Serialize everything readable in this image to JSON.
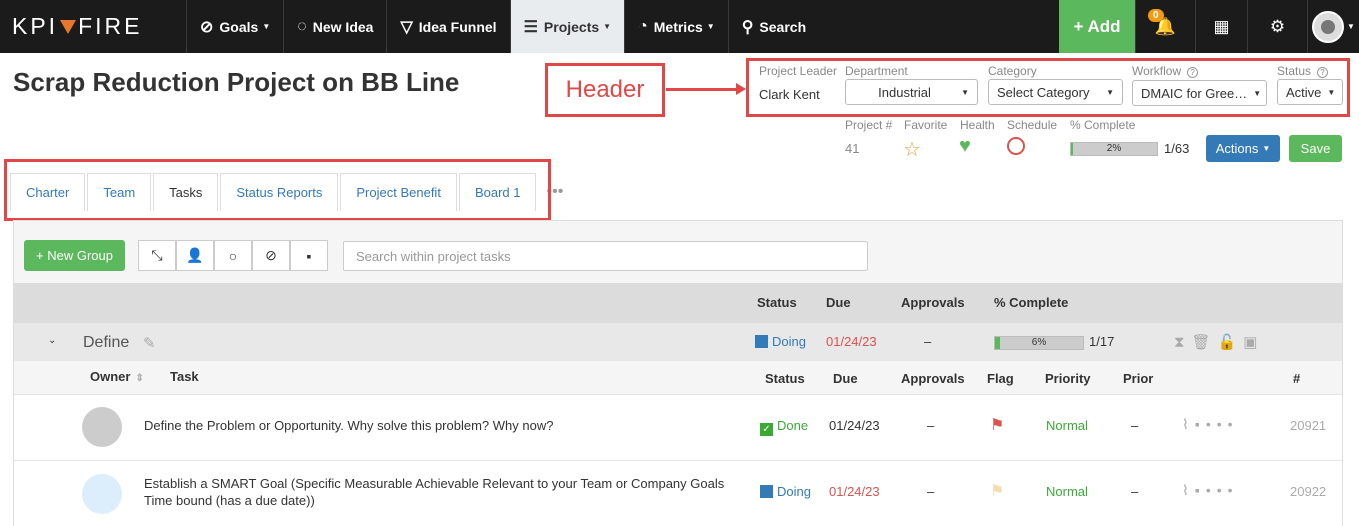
{
  "nav": {
    "logo_left": "KPI",
    "logo_right": "FIRE",
    "items": [
      {
        "label": "Goals",
        "icon": "compass-icon"
      },
      {
        "label": "New Idea",
        "icon": "lightbulb-icon"
      },
      {
        "label": "Idea Funnel",
        "icon": "funnel-icon"
      },
      {
        "label": "Projects",
        "icon": "projects-icon"
      },
      {
        "label": "Metrics",
        "icon": "gauge-icon"
      },
      {
        "label": "Search",
        "icon": "search-icon"
      }
    ],
    "add_label": "+ Add",
    "notification_count": "0"
  },
  "page": {
    "title": "Scrap Reduction Project on BB Line",
    "annotation_label": "Header"
  },
  "header": {
    "project_leader_label": "Project Leader",
    "project_leader": "Clark Kent",
    "department_label": "Department",
    "department": "Industrial",
    "category_label": "Category",
    "category": "Select Category",
    "workflow_label": "Workflow",
    "workflow": "DMAIC for Gree…",
    "status_label": "Status",
    "status": "Active",
    "project_num_label": "Project #",
    "project_num": "41",
    "favorite_label": "Favorite",
    "health_label": "Health",
    "schedule_label": "Schedule",
    "complete_label": "% Complete",
    "complete_pct": "2%",
    "complete_fraction": 0.02,
    "complete_count": "1/63",
    "actions_label": "Actions",
    "save_label": "Save"
  },
  "tabs": [
    "Charter",
    "Team",
    "Tasks",
    "Status Reports",
    "Project Benefit",
    "Board 1"
  ],
  "tabs_more": "•••",
  "toolbar": {
    "new_group_label": "+ New Group",
    "search_placeholder": "Search within project tasks"
  },
  "group_columns": {
    "status": "Status",
    "due": "Due",
    "approvals": "Approvals",
    "complete": "% Complete"
  },
  "group": {
    "name": "Define",
    "status": "Doing",
    "due": "01/24/23",
    "approvals": "–",
    "complete_pct": "6%",
    "complete_fraction": 0.06,
    "complete_count": "1/17"
  },
  "task_columns": {
    "owner": "Owner",
    "task": "Task",
    "status": "Status",
    "due": "Due",
    "approvals": "Approvals",
    "flag": "Flag",
    "priority": "Priority",
    "prior": "Prior",
    "num": "#"
  },
  "tasks": [
    {
      "task": "Define the Problem or Opportunity. Why solve this problem? Why now?",
      "status": "Done",
      "due": "01/24/23",
      "approvals": "–",
      "priority": "Normal",
      "prior": "–",
      "num": "20921"
    },
    {
      "task": "Establish a SMART Goal (Specific Measurable Achievable Relevant to your Team or Company Goals Time bound (has a due date))",
      "status": "Doing",
      "due": "01/24/23",
      "approvals": "–",
      "priority": "Normal",
      "prior": "–",
      "num": "20922"
    }
  ],
  "colors": {
    "nav_bg": "#1b1b1b",
    "green": "#5cb85c",
    "blue": "#337ab7",
    "red": "#d9534f",
    "annotation": "#e04848"
  }
}
